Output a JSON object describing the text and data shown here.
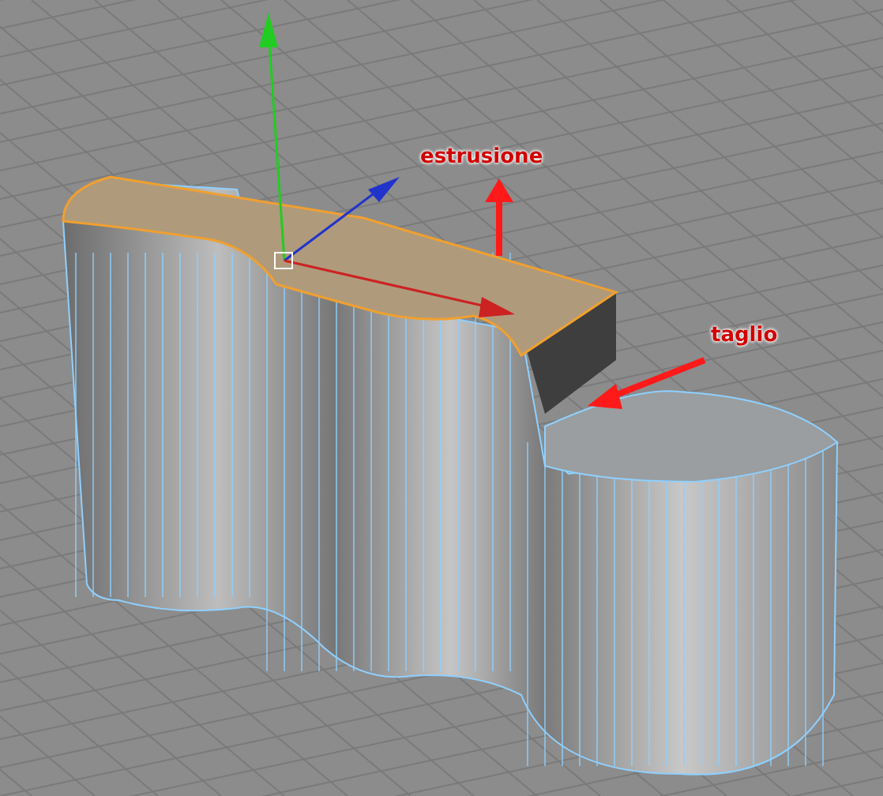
{
  "viewport": {
    "annotations": [
      {
        "text": "estrusione"
      },
      {
        "text": "taglio"
      }
    ]
  }
}
